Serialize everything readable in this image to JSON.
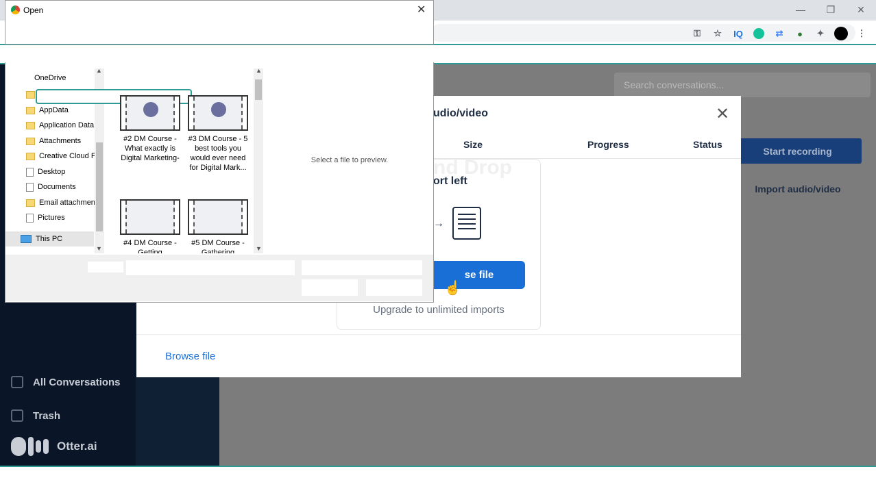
{
  "dialog": {
    "title": "Open",
    "close_label": "✕",
    "nav": {
      "onedrive": "OneDrive",
      "items": [
        "AppData",
        "Application Data",
        "Attachments",
        "Creative Cloud F",
        "Desktop",
        "Documents",
        "Email attachmen",
        "Pictures"
      ],
      "this_pc": "This PC"
    },
    "files": [
      {
        "label": "#2 DM Course - What exactly is Digital Marketing-"
      },
      {
        "label": "#3 DM Course - 5 best tools you would ever need for Digital Mark..."
      },
      {
        "label": "#4 DM Course - Getting"
      },
      {
        "label": "#5 DM Course - Gathering"
      }
    ],
    "preview_text": "Select a file to preview."
  },
  "app": {
    "search_placeholder": "Search conversations...",
    "start_recording": "Start recording",
    "import_audio_video": "Import audio/video",
    "sidebar": {
      "all_conversations": "All Conversations",
      "trash": "Trash",
      "brand": "Otter.ai"
    }
  },
  "modal": {
    "title": "udio/video",
    "close_label": "✕",
    "columns": {
      "size": "Size",
      "progress": "Progress",
      "status": "Status"
    },
    "drag_drop_ghost": "nd Drop",
    "imports_left": "ort left",
    "browse_button": "se file",
    "upgrade_text": "Upgrade to unlimited imports",
    "browse_link": "Browse file"
  },
  "colors": {
    "brand_blue": "#1a6fd6",
    "sidebar_dark": "#0a1628",
    "accent_teal": "#2e9c95"
  }
}
